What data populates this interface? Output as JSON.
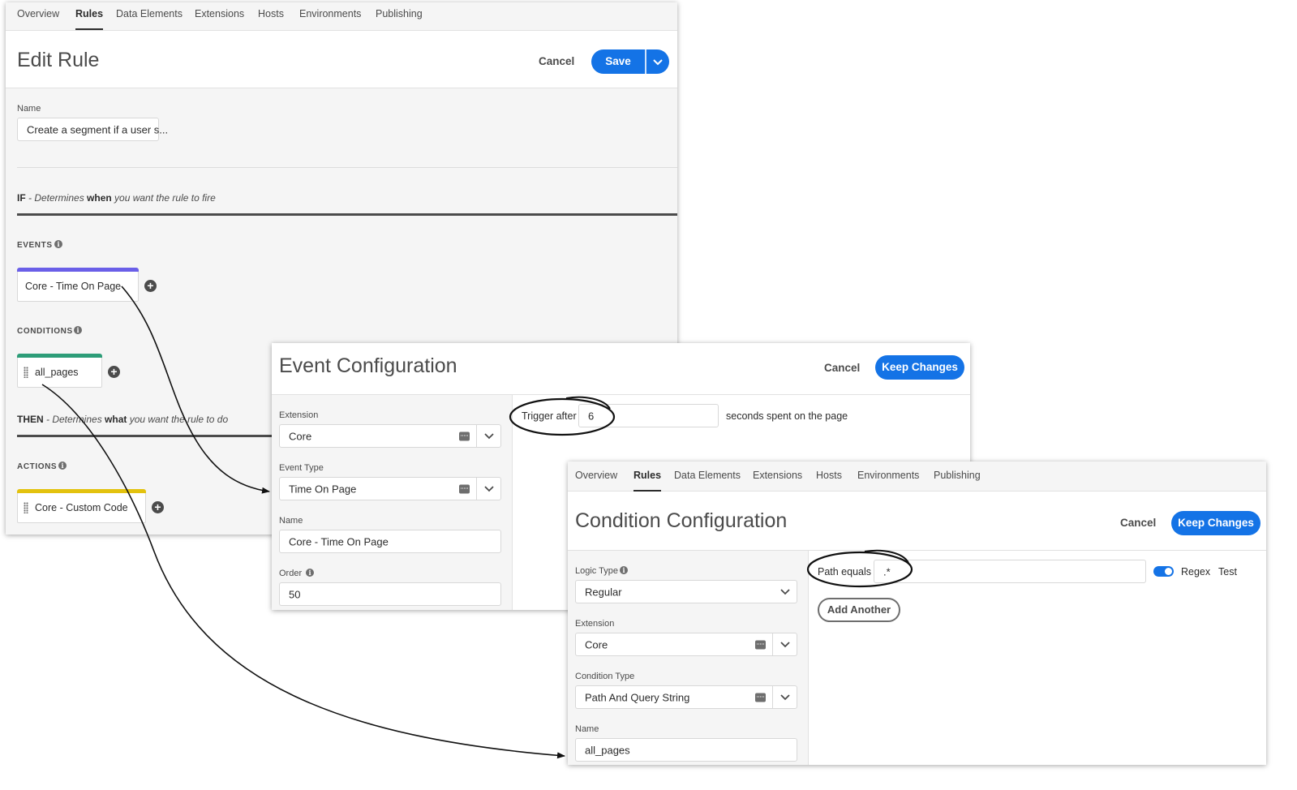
{
  "edit_rule": {
    "tabs": [
      "Overview",
      "Rules",
      "Data Elements",
      "Extensions",
      "Hosts",
      "Environments",
      "Publishing"
    ],
    "active_tab": "Rules",
    "title": "Edit Rule",
    "cancel_label": "Cancel",
    "save_label": "Save",
    "name_label": "Name",
    "name_value": "Create a segment if a user s...",
    "if_heading": "IF",
    "if_desc_pre": " - Determines ",
    "if_desc_bold": "when",
    "if_desc_post": " you want the rule to fire",
    "events_label": "EVENTS",
    "event_card": "Core - Time On Page",
    "conditions_label": "CONDITIONS",
    "condition_card": "all_pages",
    "then_heading": "THEN",
    "then_desc_pre": " - Determines ",
    "then_desc_bold": "what",
    "then_desc_post": " you want the rule to do",
    "actions_label": "ACTIONS",
    "action_card": "Core - Custom Code",
    "colors": {
      "event_bar": "#6a5fe8",
      "condition_bar": "#2d9d78",
      "action_bar": "#e3c20e"
    }
  },
  "event_config": {
    "title": "Event Configuration",
    "cancel_label": "Cancel",
    "keep_label": "Keep Changes",
    "extension_label": "Extension",
    "extension_value": "Core",
    "event_type_label": "Event Type",
    "event_type_value": "Time On Page",
    "name_label": "Name",
    "name_value": "Core - Time On Page",
    "order_label": "Order",
    "order_value": "50",
    "trigger_label": "Trigger after",
    "trigger_value": "6",
    "trigger_suffix": "seconds spent on the page"
  },
  "condition_config": {
    "tabs": [
      "Overview",
      "Rules",
      "Data Elements",
      "Extensions",
      "Hosts",
      "Environments",
      "Publishing"
    ],
    "active_tab": "Rules",
    "title": "Condition Configuration",
    "cancel_label": "Cancel",
    "keep_label": "Keep Changes",
    "logic_type_label": "Logic Type",
    "logic_type_value": "Regular",
    "extension_label": "Extension",
    "extension_value": "Core",
    "condition_type_label": "Condition Type",
    "condition_type_value": "Path And Query String",
    "name_label": "Name",
    "name_value": "all_pages",
    "path_label": "Path equals",
    "path_value": ".*",
    "regex_label": "Regex",
    "test_label": "Test",
    "add_another_label": "Add Another"
  },
  "accent_color": "#1473e6"
}
